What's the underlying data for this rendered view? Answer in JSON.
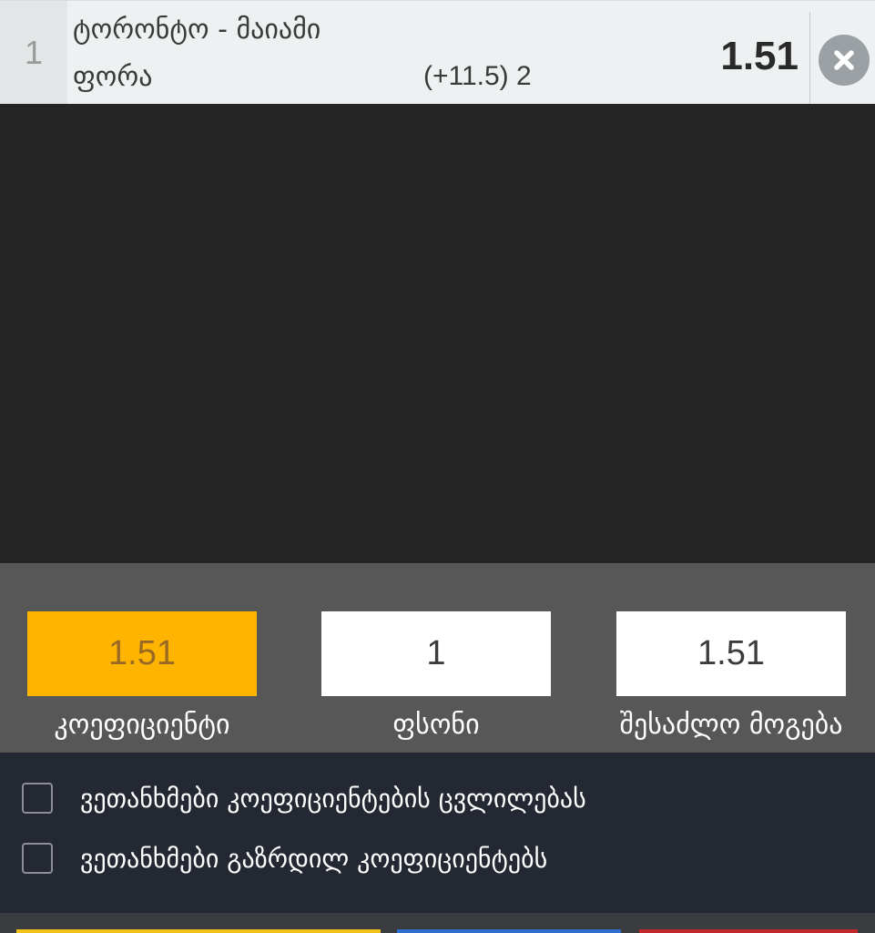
{
  "bet": {
    "index": "1",
    "event": "ტორონტო - მაიამი",
    "market": "ფორა",
    "line": "(+11.5) 2",
    "odd": "1.51",
    "remove_icon": "close-circle-icon"
  },
  "summary": {
    "odd_value": "1.51",
    "odd_label": "კოეფიციენტი",
    "stake_value": "1",
    "stake_label": "ფსონი",
    "win_value": "1.51",
    "win_label": "შესაძლო მოგება"
  },
  "options": [
    {
      "label": "ვეთანხმები კოეფიციენტების ცვლილებას",
      "checked": false
    },
    {
      "label": "ვეთანხმები გაზრდილ კოეფიციენტებს",
      "checked": false
    }
  ],
  "colors": {
    "odd_highlight": "#ffb500",
    "btn_yellow": "#f3c21a",
    "btn_blue": "#2f6fd0",
    "btn_red": "#c0282d"
  }
}
